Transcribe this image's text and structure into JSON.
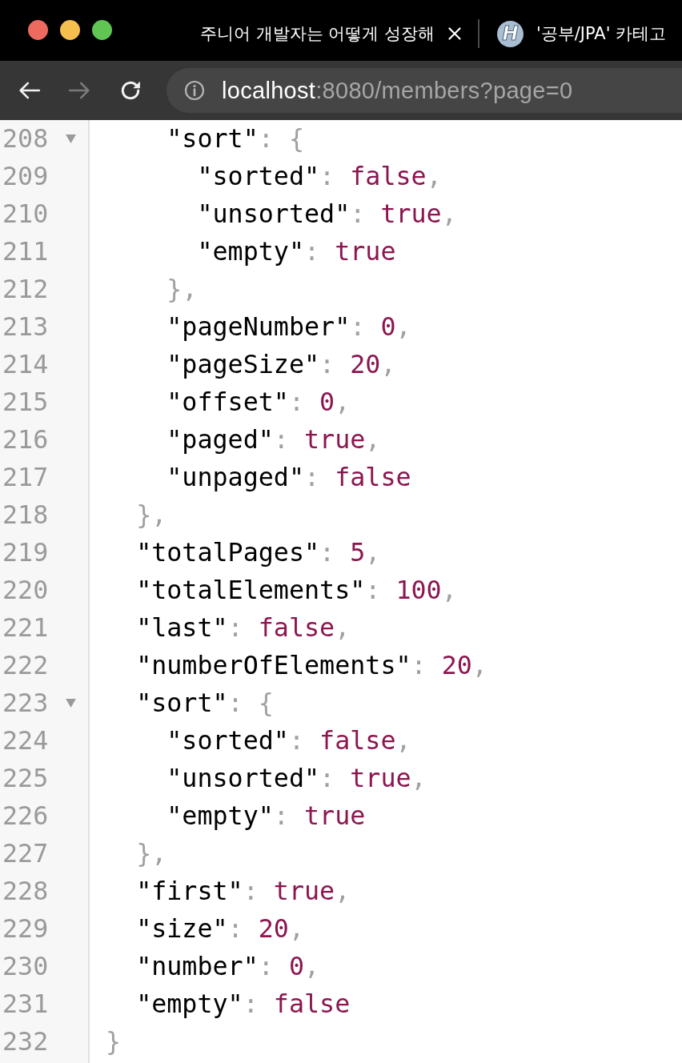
{
  "window": {
    "tabs": [
      {
        "title": "주니어 개발자는 어떻게 성장해",
        "closable": true
      },
      {
        "title": "'공부/JPA' 카테고",
        "favicon": "H",
        "closable": false
      }
    ]
  },
  "toolbar": {
    "nav_buttons": [
      {
        "kind": "back",
        "disabled": false
      },
      {
        "kind": "forward",
        "disabled": true
      },
      {
        "kind": "reload",
        "disabled": false
      }
    ],
    "address": {
      "host": "localhost",
      "path": ":8080/members?page=0"
    }
  },
  "code_view": {
    "lines": [
      {
        "children": [
          {
            "children": [
              {
                "n": "208",
                "key": "\"sort\"",
                "colon": ":",
                "brace": "{",
                "expanded": true,
                "children": [
                  {
                    "n": "209",
                    "key": "\"sorted\"",
                    "colon": ":",
                    "value": "false",
                    "comma": ","
                  },
                  {
                    "n": "210",
                    "key": "\"unsorted\"",
                    "colon": ":",
                    "value": "true",
                    "comma": ","
                  },
                  {
                    "n": "211",
                    "key": "\"empty\"",
                    "colon": ":",
                    "value": "true"
                  }
                ]
              },
              {
                "n": "212",
                "brace": "}",
                "comma": ","
              },
              {
                "n": "213",
                "key": "\"pageNumber\"",
                "colon": ":",
                "value": "0",
                "comma": ","
              },
              {
                "n": "214",
                "key": "\"pageSize\"",
                "colon": ":",
                "value": "20",
                "comma": ","
              },
              {
                "n": "215",
                "key": "\"offset\"",
                "colon": ":",
                "value": "0",
                "comma": ","
              },
              {
                "n": "216",
                "key": "\"paged\"",
                "colon": ":",
                "value": "true",
                "comma": ","
              },
              {
                "n": "217",
                "key": "\"unpaged\"",
                "colon": ":",
                "value": "false"
              }
            ]
          },
          {
            "n": "218",
            "brace": "}",
            "comma": ","
          },
          {
            "n": "219",
            "key": "\"totalPages\"",
            "colon": ":",
            "value": "5",
            "comma": ","
          },
          {
            "n": "220",
            "key": "\"totalElements\"",
            "colon": ":",
            "value": "100",
            "comma": ","
          },
          {
            "n": "221",
            "key": "\"last\"",
            "colon": ":",
            "value": "false",
            "comma": ","
          },
          {
            "n": "222",
            "key": "\"numberOfElements\"",
            "colon": ":",
            "value": "20",
            "comma": ","
          },
          {
            "n": "223",
            "key": "\"sort\"",
            "colon": ":",
            "brace": "{",
            "expanded": true,
            "children": [
              {
                "n": "224",
                "key": "\"sorted\"",
                "colon": ":",
                "value": "false",
                "comma": ","
              },
              {
                "n": "225",
                "key": "\"unsorted\"",
                "colon": ":",
                "value": "true",
                "comma": ","
              },
              {
                "n": "226",
                "key": "\"empty\"",
                "colon": ":",
                "value": "true"
              }
            ]
          },
          {
            "n": "227",
            "brace": "}",
            "comma": ","
          },
          {
            "n": "228",
            "key": "\"first\"",
            "colon": ":",
            "value": "true",
            "comma": ","
          },
          {
            "n": "229",
            "key": "\"size\"",
            "colon": ":",
            "value": "20",
            "comma": ","
          },
          {
            "n": "230",
            "key": "\"number\"",
            "colon": ":",
            "value": "0",
            "comma": ","
          },
          {
            "n": "231",
            "key": "\"empty\"",
            "colon": ":",
            "value": "false"
          }
        ]
      },
      {
        "n": "232",
        "brace": "}"
      }
    ]
  }
}
